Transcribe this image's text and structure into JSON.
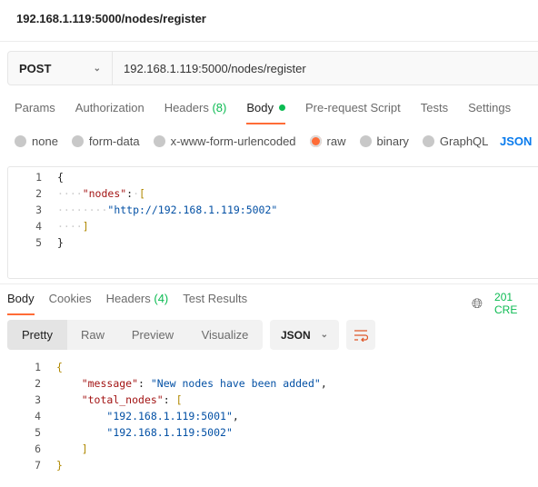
{
  "title": "192.168.1.119:5000/nodes/register",
  "request": {
    "method": "POST",
    "url": "192.168.1.119:5000/nodes/register"
  },
  "req_tabs": [
    {
      "label": "Params"
    },
    {
      "label": "Authorization"
    },
    {
      "label": "Headers",
      "count": "(8)"
    },
    {
      "label": "Body",
      "active": true,
      "dot": true
    },
    {
      "label": "Pre-request Script"
    },
    {
      "label": "Tests"
    },
    {
      "label": "Settings"
    }
  ],
  "body_types": [
    {
      "label": "none"
    },
    {
      "label": "form-data"
    },
    {
      "label": "x-www-form-urlencoded"
    },
    {
      "label": "raw",
      "selected": true
    },
    {
      "label": "binary"
    },
    {
      "label": "GraphQL"
    }
  ],
  "body_format": "JSON",
  "request_body": [
    [
      [
        "p",
        "{"
      ]
    ],
    [
      [
        "ws",
        "····"
      ],
      [
        "k",
        "\"nodes\""
      ],
      [
        "p",
        ":"
      ],
      [
        "ws",
        "·"
      ],
      [
        "br",
        "["
      ]
    ],
    [
      [
        "ws",
        "········"
      ],
      [
        "s",
        "\"http://192.168.1.119:5002\""
      ]
    ],
    [
      [
        "ws",
        "····"
      ],
      [
        "br",
        "]"
      ]
    ],
    [
      [
        "p",
        "}"
      ]
    ]
  ],
  "resp_tabs": [
    {
      "label": "Body",
      "active": true
    },
    {
      "label": "Cookies"
    },
    {
      "label": "Headers",
      "count": "(4)"
    },
    {
      "label": "Test Results"
    }
  ],
  "status": "201 CRE",
  "view_modes": [
    "Pretty",
    "Raw",
    "Preview",
    "Visualize"
  ],
  "resp_format": "JSON",
  "response_body": [
    [
      [
        "br",
        "{"
      ]
    ],
    [
      [
        "p",
        "    "
      ],
      [
        "k",
        "\"message\""
      ],
      [
        "p",
        ": "
      ],
      [
        "s",
        "\"New nodes have been added\""
      ],
      [
        "p",
        ","
      ]
    ],
    [
      [
        "p",
        "    "
      ],
      [
        "k",
        "\"total_nodes\""
      ],
      [
        "p",
        ": "
      ],
      [
        "br",
        "["
      ]
    ],
    [
      [
        "p",
        "        "
      ],
      [
        "s",
        "\"192.168.1.119:5001\""
      ],
      [
        "p",
        ","
      ]
    ],
    [
      [
        "p",
        "        "
      ],
      [
        "s",
        "\"192.168.1.119:5002\""
      ]
    ],
    [
      [
        "p",
        "    "
      ],
      [
        "br",
        "]"
      ]
    ],
    [
      [
        "br",
        "}"
      ]
    ]
  ],
  "colors": {
    "accent": "#ff6c37",
    "success": "#0cbb52",
    "link": "#097bed"
  }
}
